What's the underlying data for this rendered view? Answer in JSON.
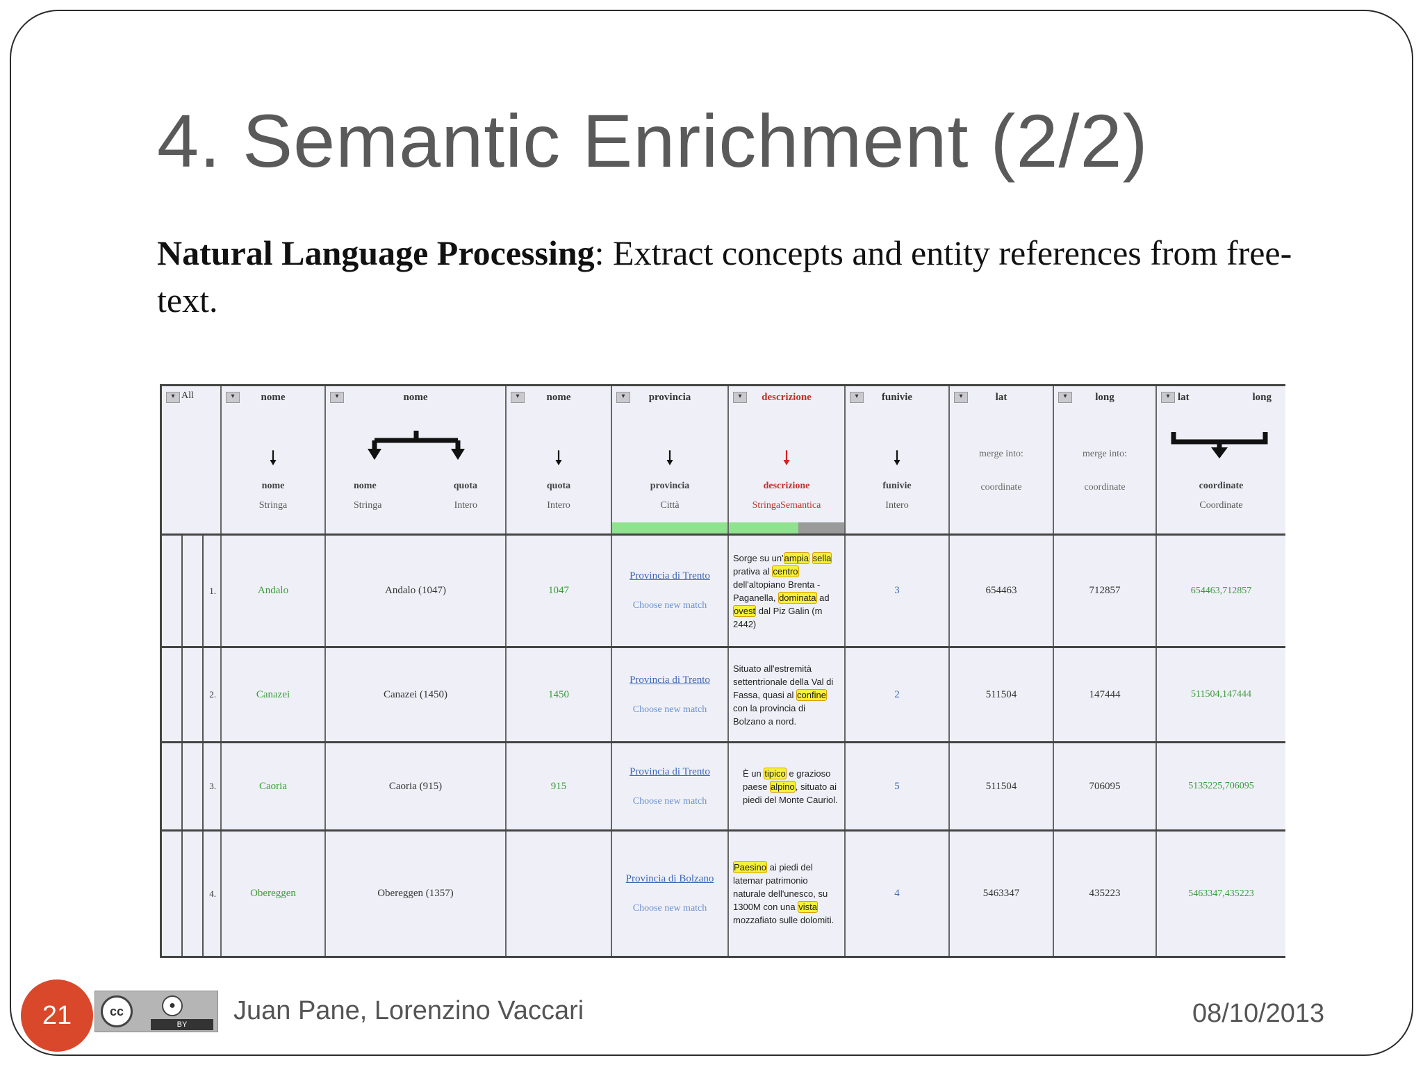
{
  "slide": {
    "title": "4. Semantic Enrichment (2/2)",
    "intro_bold": "Natural Language Processing",
    "intro_rest": ": Extract concepts and entity references from free-text.",
    "page_number": "21",
    "authors": "Juan Pane, Lorenzino Vaccari",
    "date": "08/10/2013",
    "license": {
      "cc": "cc",
      "by": "BY"
    }
  },
  "table": {
    "all_label": "All",
    "headers": {
      "c1": {
        "name": "nome",
        "new": "nome",
        "type": "Stringa"
      },
      "c2": {
        "name": "nome",
        "left": "nome",
        "left_type": "Stringa",
        "right": "quota",
        "right_type": "Intero"
      },
      "c3": {
        "name": "nome",
        "new": "quota",
        "type": "Intero"
      },
      "c4": {
        "name": "provincia",
        "new": "provincia",
        "type": "Città"
      },
      "c5": {
        "name": "descrizione",
        "new": "descrizione",
        "type": "StringaSemantica"
      },
      "c6": {
        "name": "funivie",
        "new": "funivie",
        "type": "Intero"
      },
      "c7": {
        "name": "lat",
        "merge": "merge into:",
        "target": "coordinate"
      },
      "c8": {
        "name": "long",
        "merge": "merge into:",
        "target": "coordinate"
      },
      "c9": {
        "name_left": "lat",
        "name_right": "long",
        "new": "coordinate",
        "type": "Coordinate"
      }
    },
    "rows": [
      {
        "num": "1.",
        "nome": "Andalo",
        "nome_quota": "Andalo (1047)",
        "quota": "1047",
        "provincia": "Provincia di Trento",
        "choose": "Choose new match",
        "desc": [
          "Sorge",
          " su un'",
          "ampia",
          " ",
          "sella",
          " prativa al ",
          "centro",
          " dell'altopiano Brenta - Paganella, ",
          "dominata",
          " ad ",
          "ovest",
          " dal Piz Galin (m 2442)"
        ],
        "funivie": "3",
        "lat": "654463",
        "long": "712857",
        "coord": "654463,712857"
      },
      {
        "num": "2.",
        "nome": "Canazei",
        "nome_quota": "Canazei (1450)",
        "quota": "1450",
        "provincia": "Provincia di Trento",
        "choose": "Choose new match",
        "desc": [
          "Situato all'estremità settentrionale della Val di Fassa, quasi al ",
          "confine",
          " con la provincia di Bolzano a nord."
        ],
        "funivie": "2",
        "lat": "511504",
        "long": "147444",
        "coord": "511504,147444"
      },
      {
        "num": "3.",
        "nome": "Caoria",
        "nome_quota": "Caoria (915)",
        "quota": "915",
        "provincia": "Provincia di Trento",
        "choose": "Choose new match",
        "desc": [
          "È un ",
          "tipico",
          " e grazioso paese ",
          "alpino",
          ", situato ai piedi del Monte Cauriol."
        ],
        "funivie": "5",
        "lat": "511504",
        "long": "706095",
        "coord": "5135225,706095"
      },
      {
        "num": "4.",
        "nome": "Obereggen",
        "nome_quota": "Obereggen (1357)",
        "quota": "",
        "provincia": "Provincia di Bolzano",
        "choose": "Choose new match",
        "desc": [
          "Paesino",
          " ai piedi del latemar patrimonio naturale dell'unesco, su 1300M con una ",
          "vista",
          " mozzafiato sulle dolomiti."
        ],
        "funivie": "4",
        "lat": "5463347",
        "long": "435223",
        "coord": "5463347,435223"
      }
    ]
  }
}
